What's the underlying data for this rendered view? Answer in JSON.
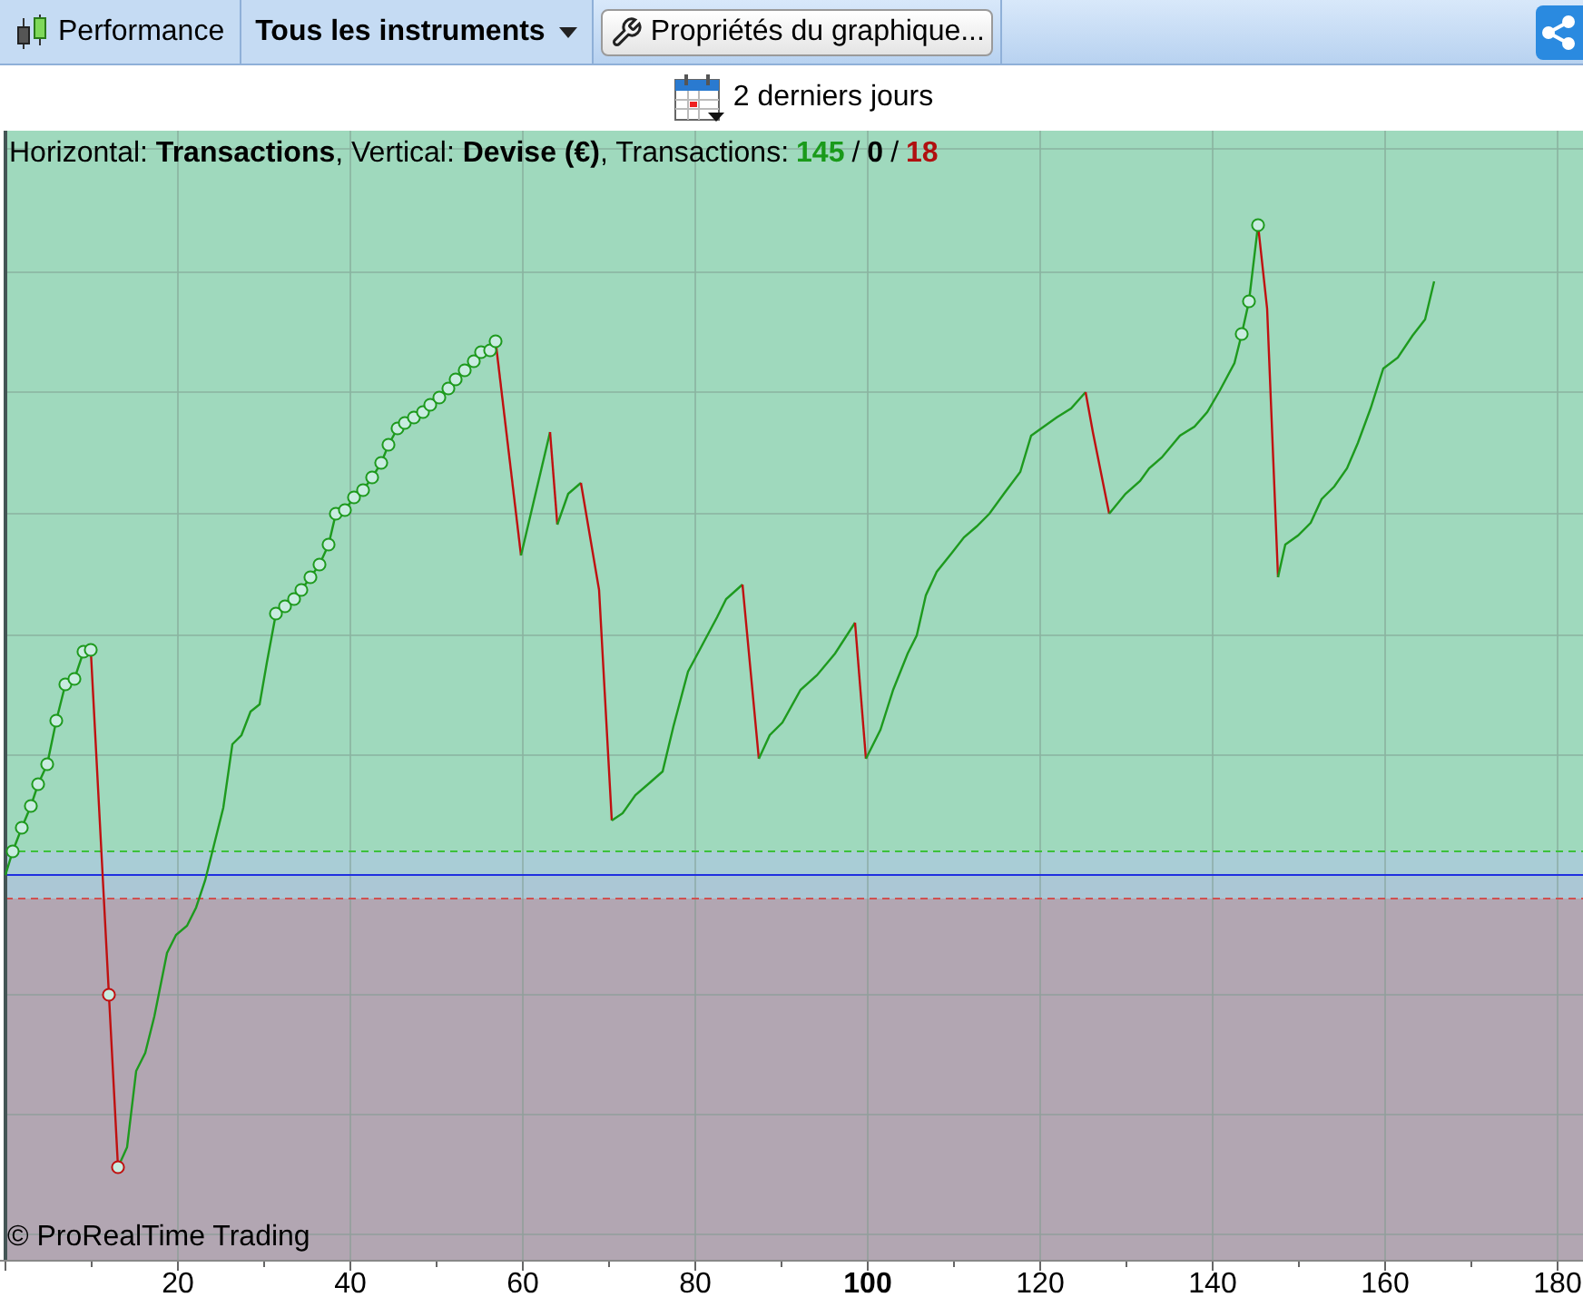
{
  "toolbar": {
    "items": [
      {
        "kind": "tab",
        "label": "Performance"
      },
      {
        "kind": "dropdown",
        "label": "Tous les instruments"
      },
      {
        "kind": "button",
        "label": "Propriétés du graphique..."
      }
    ]
  },
  "period": {
    "label": "2 derniers jours"
  },
  "chart": {
    "legend": {
      "text": "Horizontal: **Transactions**, Vertical: **Devise (€)**, Transactions:",
      "counts": [
        {
          "value": "145",
          "color": "#1a9a1a"
        },
        {
          "value": "0",
          "color": "#000000"
        },
        {
          "value": "18",
          "color": "#b01010"
        }
      ],
      "separators": [
        "/",
        "/"
      ]
    },
    "copyright": "© ProRealTime Trading",
    "x_ticks": [
      {
        "label": "20",
        "bold": false
      },
      {
        "label": "40",
        "bold": false
      },
      {
        "label": "60",
        "bold": false
      },
      {
        "label": "80",
        "bold": false
      },
      {
        "label": "100",
        "bold": true
      },
      {
        "label": "120",
        "bold": false
      },
      {
        "label": "140",
        "bold": false
      },
      {
        "label": "160",
        "bold": false
      },
      {
        "label": "180",
        "bold": false
      }
    ]
  }
}
